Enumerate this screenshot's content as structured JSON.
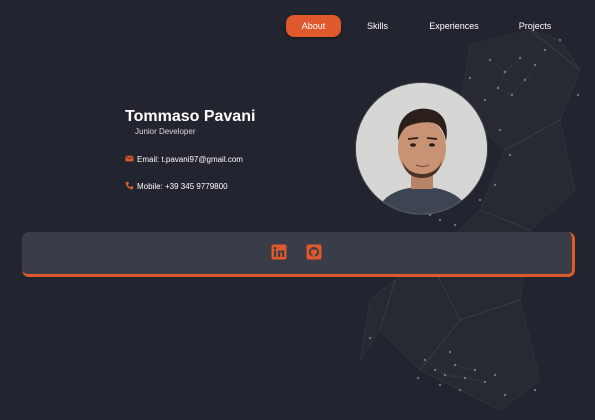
{
  "nav": {
    "items": [
      {
        "label": "About",
        "active": true
      },
      {
        "label": "Skills",
        "active": false
      },
      {
        "label": "Experiences",
        "active": false
      },
      {
        "label": "Projects",
        "active": false
      }
    ]
  },
  "profile": {
    "name": "Tommaso Pavani",
    "role": "Junior Developer",
    "email_text": "Email: t.pavani97@gmail.com",
    "phone_text": "Mobile: +39 345 9779800",
    "email_icon": "envelope-icon",
    "phone_icon": "phone-icon",
    "avatar": "profile-photo"
  },
  "social": {
    "links": [
      {
        "icon": "linkedin-icon"
      },
      {
        "icon": "github-icon"
      }
    ]
  },
  "colors": {
    "background": "#22252f",
    "card": "#3a3d47",
    "accent": "#e0592c",
    "text": "#ffffff"
  }
}
